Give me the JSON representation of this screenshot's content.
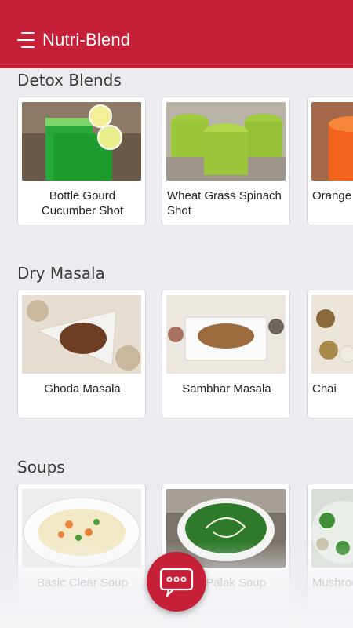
{
  "header": {
    "title": "Nutri-Blend",
    "menu_icon": "hamburger-menu-icon",
    "background": "#c52038"
  },
  "sections": [
    {
      "title": "Detox Blends",
      "cards": [
        {
          "label": "Bottle Gourd Cucumber Shot"
        },
        {
          "label": "Wheat Grass Spinach Shot"
        },
        {
          "label": "Orange Mosam"
        }
      ]
    },
    {
      "title": "Dry Masala",
      "cards": [
        {
          "label": "Ghoda Masala"
        },
        {
          "label": "Sambhar Masala"
        },
        {
          "label": "Chai"
        }
      ]
    },
    {
      "title": "Soups",
      "cards": [
        {
          "label": "Basic Clear Soup"
        },
        {
          "label": "kin Palak Soup"
        },
        {
          "label": "Mushroo Soup"
        }
      ]
    }
  ],
  "fab": {
    "icon": "chat-bubble-icon"
  }
}
